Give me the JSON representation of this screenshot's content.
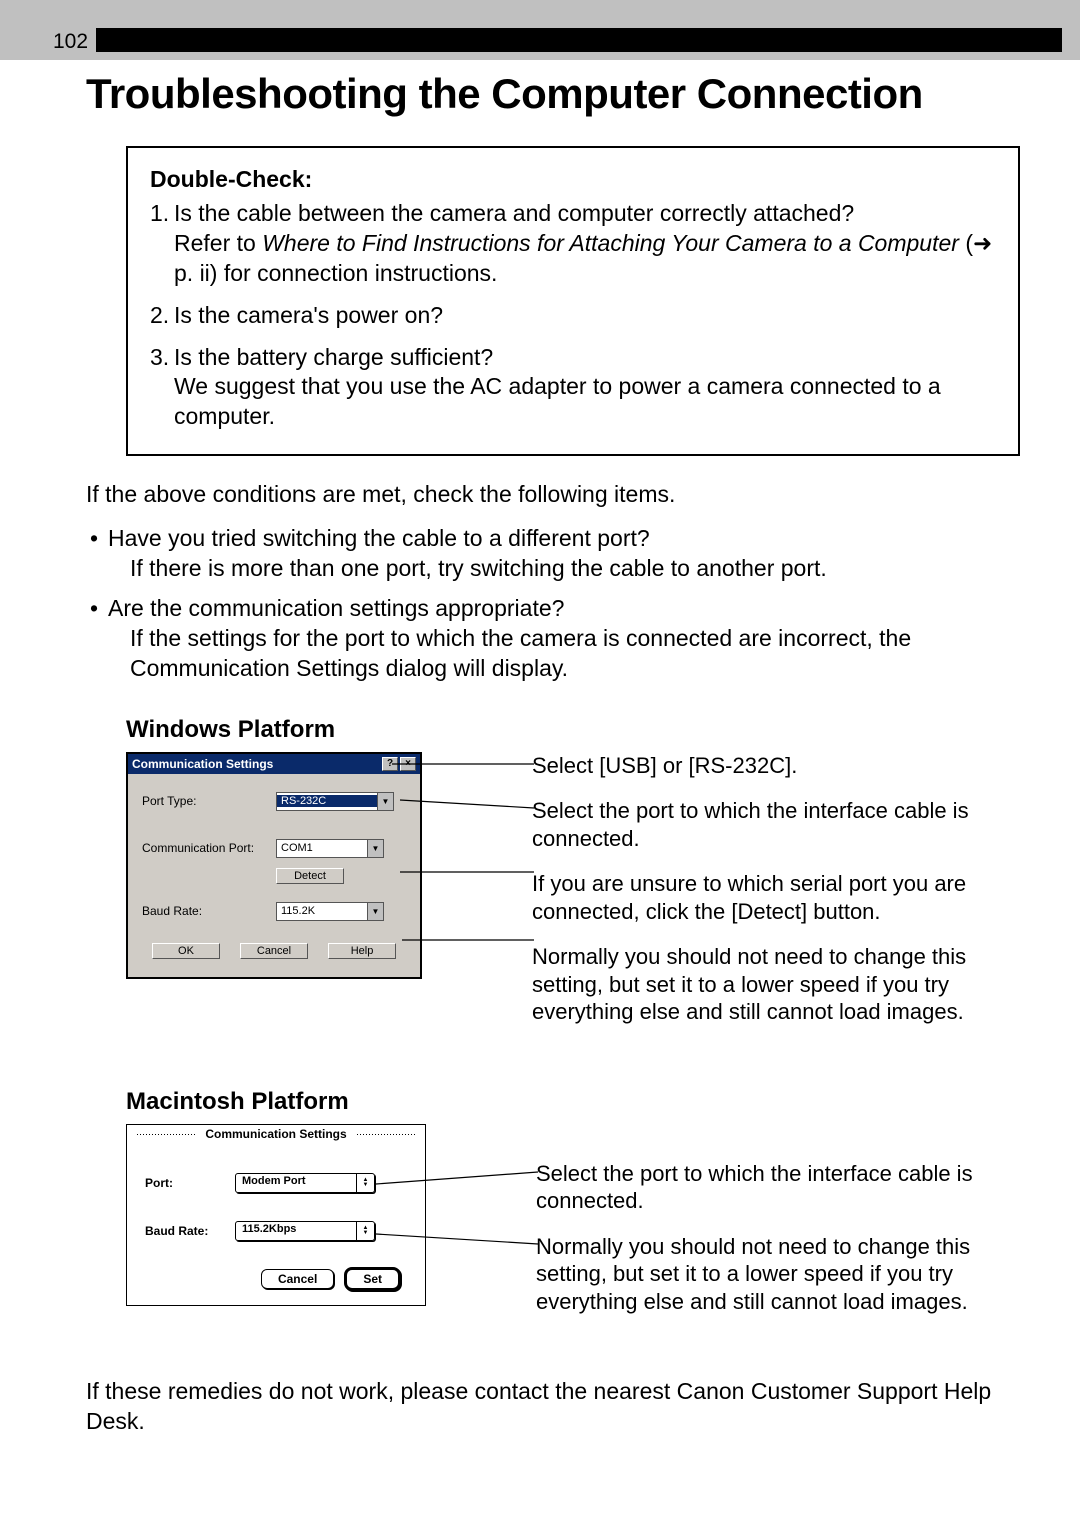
{
  "page_number": "102",
  "title": "Troubleshooting the Computer Connection",
  "doublecheck": {
    "heading": "Double-Check:",
    "items": [
      {
        "num": "1.",
        "line1": "Is the cable between the camera and computer correctly attached?",
        "line2_lead": "Refer to ",
        "line2_ital": "Where to Find Instructions for Attaching Your Camera to a Computer",
        "line2_tail": " (➜ p. ii) for connection instructions."
      },
      {
        "num": "2.",
        "line1": "Is the camera's power on?"
      },
      {
        "num": "3.",
        "line1": "Is the battery charge sufficient?",
        "line2_plain": "We suggest that you use the AC adapter to power a camera connected to a computer."
      }
    ]
  },
  "intro_para": "If the above conditions are met, check the following items.",
  "bullets": [
    {
      "main": "Have you tried switching the cable to a different port?",
      "sub": "If there is more than one port, try switching the cable to another port."
    },
    {
      "main": "Are the communication settings appropriate?",
      "sub": "If the settings for the port to which the camera is connected are incorrect, the Communication Settings dialog will display."
    }
  ],
  "windows": {
    "heading": "Windows Platform",
    "dialog_title": "Communication Settings",
    "port_type_label": "Port Type:",
    "port_type_value": "RS-232C",
    "comm_port_label": "Communication Port:",
    "comm_port_value": "COM1",
    "detect_label": "Detect",
    "baud_label": "Baud Rate:",
    "baud_value": "115.2K",
    "ok": "OK",
    "cancel": "Cancel",
    "help": "Help",
    "notes": [
      "Select [USB] or [RS-232C].",
      "Select the port to which the interface cable is connected.",
      "If you are unsure to which serial port you are connected, click the [Detect] button.",
      "Normally you should not need to change this setting, but set it to a lower speed if you try everything else and still cannot load images."
    ]
  },
  "mac": {
    "heading": "Macintosh Platform",
    "dialog_title": "Communication Settings",
    "port_label": "Port:",
    "port_value": "Modem Port",
    "baud_label": "Baud Rate:",
    "baud_value": "115.2Kbps",
    "cancel": "Cancel",
    "set": "Set",
    "notes": [
      "Select the port to which the interface cable is connected.",
      "Normally you should not need to change this setting, but set it to a lower speed if you try everything else and still cannot load images."
    ]
  },
  "closing": "If these remedies do not work, please contact the nearest Canon Customer Support Help Desk."
}
